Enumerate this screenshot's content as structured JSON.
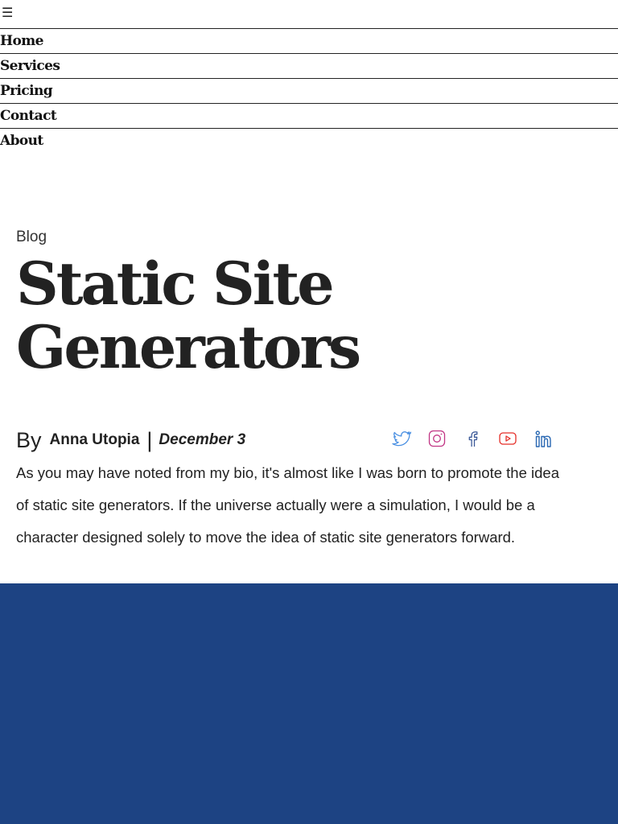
{
  "header": {
    "menu_icon": "☰"
  },
  "nav": {
    "items": [
      {
        "label": "Home"
      },
      {
        "label": "Services"
      },
      {
        "label": "Pricing"
      },
      {
        "label": "Contact"
      },
      {
        "label": "About"
      }
    ]
  },
  "article": {
    "category": "Blog",
    "title": "Static Site Generators",
    "byline": {
      "prefix": "By",
      "author": "Anna Utopia",
      "separator": "|",
      "date": "December 3"
    },
    "body": "As you may have noted from my bio, it's almost like I was born to promote the idea of static site generators. If the universe actually were a simulation, I would be a character designed solely to move the idea of static site generators forward."
  },
  "social": [
    {
      "icon": "twitter-icon",
      "color": "#4a90e2"
    },
    {
      "icon": "instagram-icon",
      "color": "#c13584"
    },
    {
      "icon": "facebook-icon",
      "color": "#3b5998"
    },
    {
      "icon": "youtube-icon",
      "color": "#e52d27"
    },
    {
      "icon": "linkedin-icon",
      "color": "#2867b2"
    }
  ],
  "colors": {
    "text": "#222222",
    "footer_background": "#1d4383"
  }
}
